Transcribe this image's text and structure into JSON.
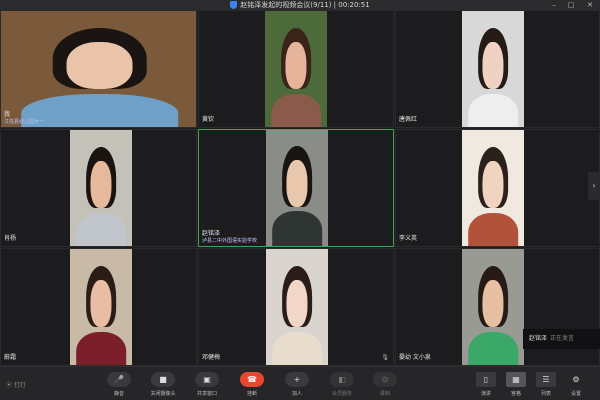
{
  "window": {
    "title": "赵铭泽发起的视频会议(9/11) | 00:20:51",
    "controls": [
      "–",
      "□",
      "✕"
    ]
  },
  "participants": [
    {
      "name": "我",
      "sub": "江信县幼儿园大一",
      "skin": "#e9c4a8",
      "hair": "#1a1412",
      "shirt": "#6fa0c8",
      "bg": "#7a5a3a"
    },
    {
      "name": "黄钦",
      "sub": "",
      "skin": "#e5b49a",
      "hair": "#3a2418",
      "shirt": "#8a5a4a",
      "bg": "#4c6a3a"
    },
    {
      "name": "唐佩红",
      "sub": "",
      "skin": "#f0d2c2",
      "hair": "#241a16",
      "shirt": "#eeeeee",
      "bg": "#d8d8d8"
    },
    {
      "name": "肖杨",
      "sub": "",
      "skin": "#e6b89c",
      "hair": "#1a1310",
      "shirt": "#c0c6cc",
      "bg": "#c4c1b8"
    },
    {
      "name": "赵铭泽",
      "sub": "泸县二中外国语实验学校",
      "skin": "#e8c7ad",
      "hair": "#191513",
      "shirt": "#2f3533",
      "bg": "#8a8c88"
    },
    {
      "name": "李义英",
      "sub": "",
      "skin": "#f1d4c0",
      "hair": "#2b201c",
      "shirt": "#b0533a",
      "bg": "#efe9df"
    },
    {
      "name": "蔚霜",
      "sub": "",
      "skin": "#e9bca4",
      "hair": "#2a1c16",
      "shirt": "#7a1f2a",
      "bg": "#c9b9a7"
    },
    {
      "name": "邓健梅",
      "sub": "",
      "skin": "#f2d7c8",
      "hair": "#2a1d19",
      "shirt": "#e8dccc",
      "bg": "#dad4cf"
    },
    {
      "name": "晏幼 文小泉",
      "sub": "",
      "skin": "#e7bfa2",
      "hair": "#251a16",
      "shirt": "#3ba86a",
      "bg": "#9a9a94"
    }
  ],
  "speaking": {
    "name": "赵铭泽",
    "status": "正在发言"
  },
  "toolbar": {
    "record": "⦿ 打灯",
    "buttons": [
      {
        "icon": "🎤",
        "label": "静音"
      },
      {
        "icon": "■",
        "label": "关闭摄像头"
      },
      {
        "icon": "▣",
        "label": "共享窗口"
      },
      {
        "icon": "☎",
        "label": "挂断"
      },
      {
        "icon": "+",
        "label": "加人"
      },
      {
        "icon": "◧",
        "label": "会员服务"
      },
      {
        "icon": "⊙",
        "label": "录制"
      }
    ],
    "layouts": [
      {
        "icon": "▯",
        "label": "演讲"
      },
      {
        "icon": "▦",
        "label": "宫格"
      },
      {
        "icon": "☰",
        "label": "列表"
      }
    ],
    "settings": {
      "icon": "⚙",
      "label": "设置"
    }
  },
  "colors": {
    "accent_green": "#3ba55c",
    "hangup_red": "#e8462e",
    "background": "#1e1e21"
  }
}
